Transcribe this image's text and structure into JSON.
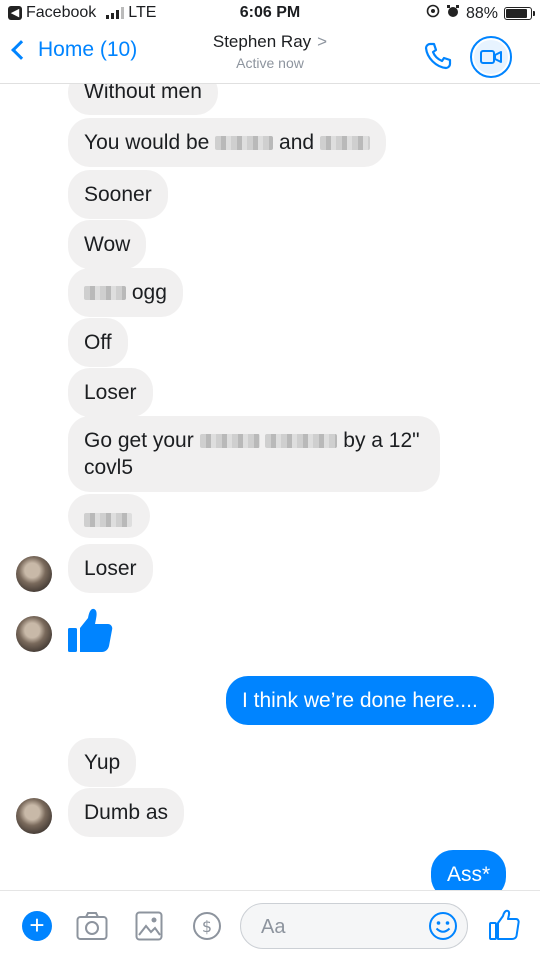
{
  "status_bar": {
    "back_app": "Facebook",
    "network": "LTE",
    "time": "6:06 PM",
    "battery": "88%",
    "battery_level": 0.88
  },
  "header": {
    "back_label": "Home (10)",
    "contact_name": "Stephen Ray",
    "contact_status": "Active now"
  },
  "messages": [
    {
      "text": "Without men"
    },
    {
      "a": "You would be",
      "b": "and"
    },
    {
      "text": "Sooner"
    },
    {
      "text": "Wow"
    },
    {
      "text": "ogg"
    },
    {
      "text": "Off"
    },
    {
      "text": "Loser"
    },
    {
      "a": "Go get your",
      "b": "by a 12\"",
      "c": "covl5"
    },
    {
      "text": "Loser"
    },
    {
      "text": "I think we’re done here...."
    },
    {
      "text": "Yup"
    },
    {
      "text": "Dumb as"
    },
    {
      "text": "Ass*"
    }
  ],
  "composer": {
    "placeholder": "Aa"
  },
  "colors": {
    "accent": "#0084ff",
    "incoming_bubble": "#f1f0f0"
  },
  "icons": [
    "camera-icon",
    "image-icon",
    "payment-icon",
    "emoji-icon",
    "like-icon",
    "phone-icon",
    "video-icon",
    "plus-icon"
  ]
}
